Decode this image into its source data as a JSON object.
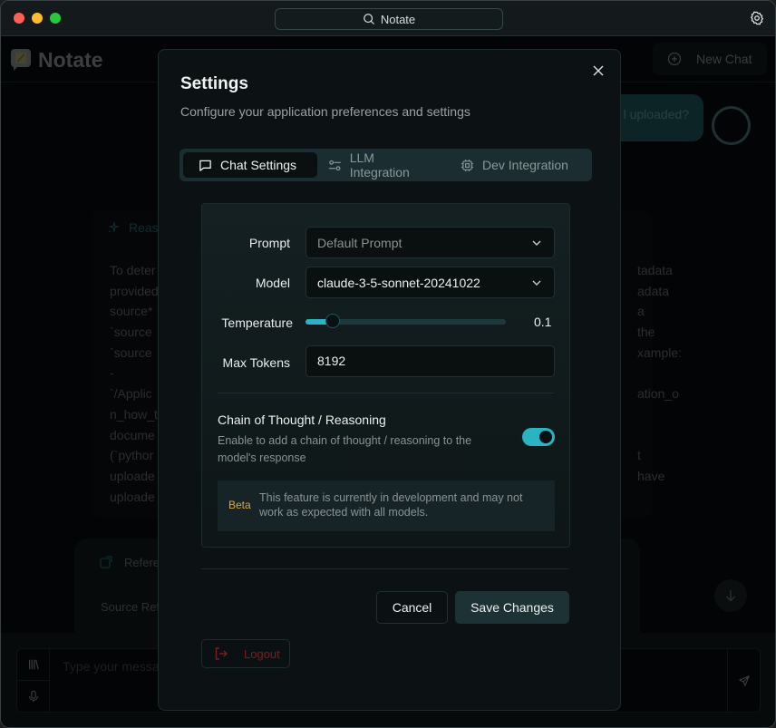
{
  "titlebar": {
    "search_label": "Notate",
    "icons": {
      "search": "search-icon",
      "settings": "gear-icon"
    }
  },
  "app": {
    "title": "Notate",
    "new_chat_label": "New Chat",
    "user_message_fragment": "l uploaded?",
    "reasoning": {
      "label": "Reas",
      "lines_left": [
        "To deter",
        "provided",
        "source*",
        "`source",
        "`source",
        "-",
        "`/Applic",
        "n_how_t",
        "docume",
        "(`pythor",
        "uploade",
        "uploade"
      ],
      "lines_right": [
        "tadata",
        "adata",
        "a",
        "the",
        "xample:",
        "",
        "ation_o",
        "",
        "",
        "t",
        "have",
        ""
      ]
    },
    "references": {
      "label": "Refere",
      "sub_label": "Source Ref"
    },
    "composer_placeholder": "Type your message"
  },
  "modal": {
    "title": "Settings",
    "description": "Configure your application preferences and settings",
    "tabs": [
      {
        "label": "Chat Settings",
        "icon": "chat-icon",
        "active": true
      },
      {
        "label": "LLM Integration",
        "icon": "sliders-icon",
        "active": false
      },
      {
        "label": "Dev Integration",
        "icon": "chip-icon",
        "active": false
      }
    ],
    "chat_settings": {
      "prompt": {
        "label": "Prompt",
        "placeholder": "Default Prompt"
      },
      "model": {
        "label": "Model",
        "value": "claude-3-5-sonnet-20241022"
      },
      "temperature": {
        "label": "Temperature",
        "value": 0.1,
        "display": "0.1",
        "min": 0,
        "max": 1
      },
      "max_tokens": {
        "label": "Max Tokens",
        "value": "8192"
      },
      "chain_of_thought": {
        "title": "Chain of Thought / Reasoning",
        "description": "Enable to add a chain of thought / reasoning to the model's response",
        "enabled": true
      },
      "beta_notice": {
        "tag": "Beta",
        "text": "This feature is currently in development and may not work as expected with all models."
      }
    },
    "buttons": {
      "cancel": "Cancel",
      "save": "Save Changes",
      "logout": "Logout"
    }
  },
  "colors": {
    "accent": "#2ab3c0",
    "beta": "#e2a637",
    "logout": "#7a1e1e"
  }
}
